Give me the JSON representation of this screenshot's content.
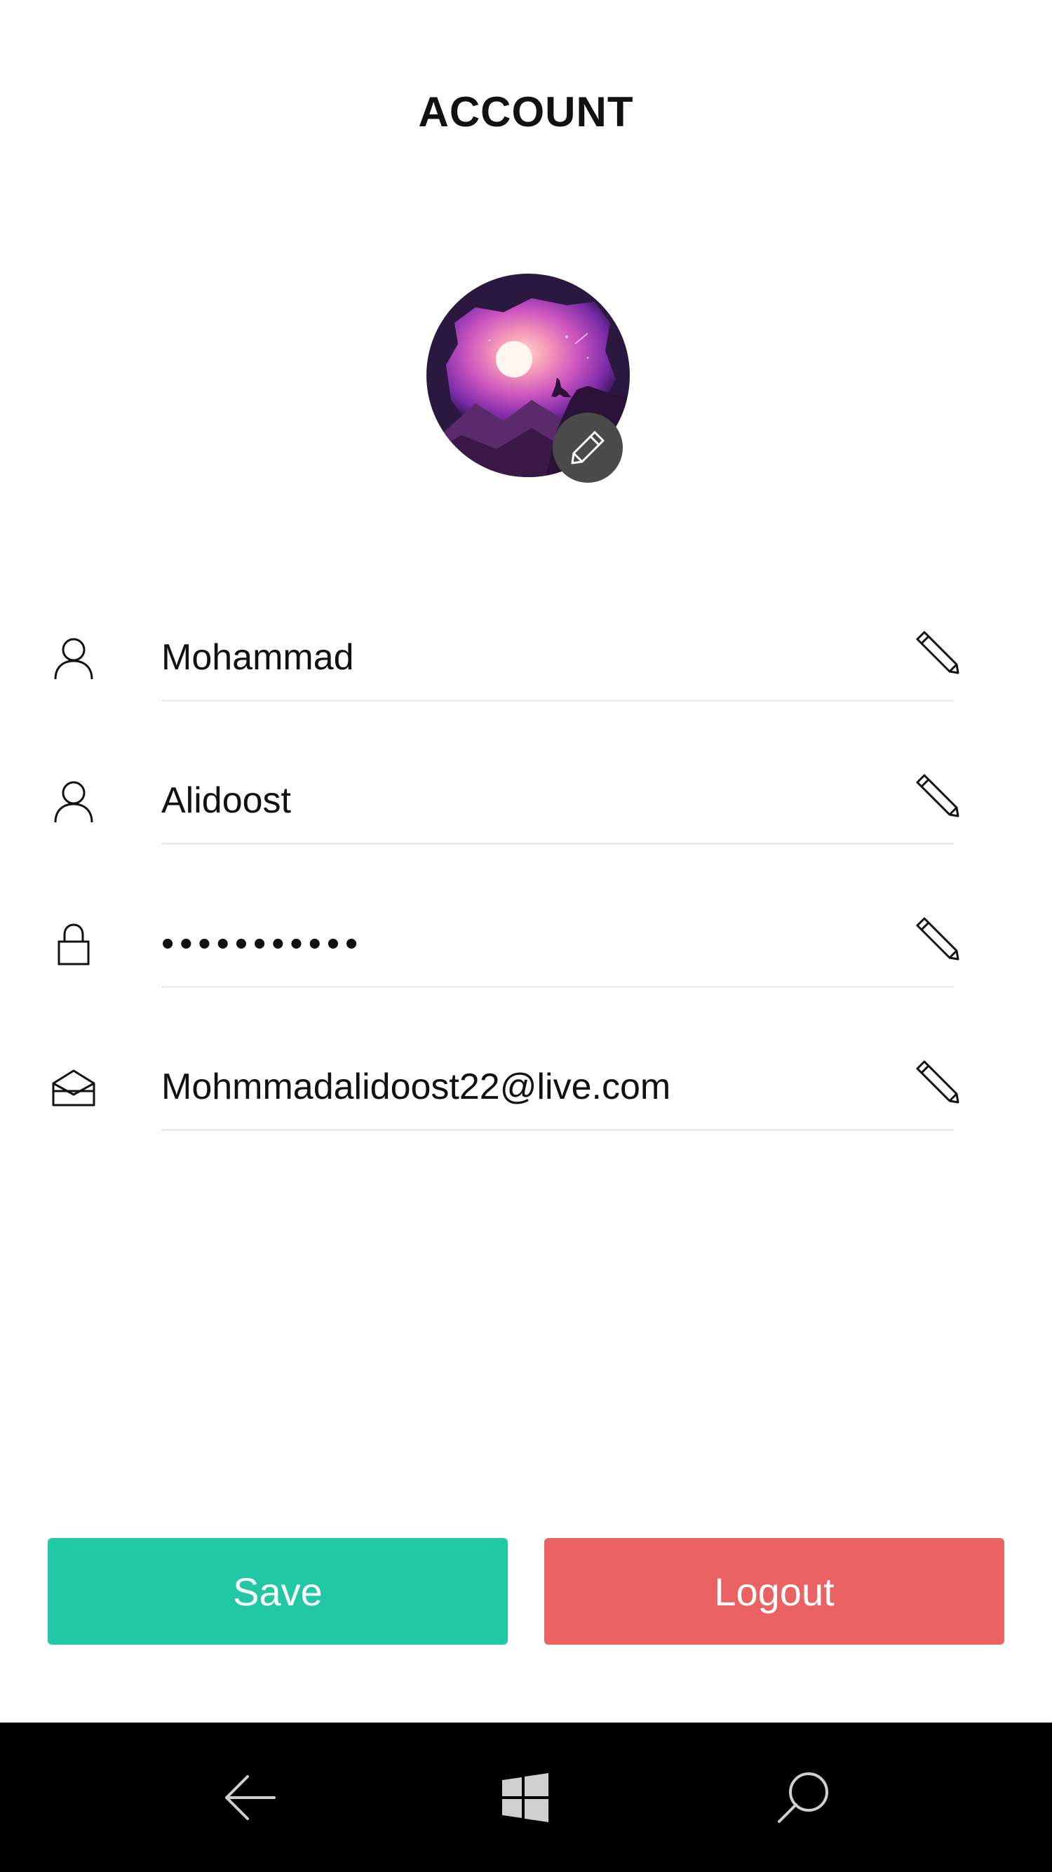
{
  "header": {
    "title": "ACCOUNT"
  },
  "avatar": {
    "image": "night-landscape-wolf-moon",
    "edit_icon": "pencil-icon"
  },
  "fields": [
    {
      "name": "first-name",
      "icon": "user-icon",
      "value": "Mohammad",
      "edit_icon": "pencil-icon"
    },
    {
      "name": "last-name",
      "icon": "user-icon",
      "value": "Alidoost",
      "edit_icon": "pencil-icon"
    },
    {
      "name": "password",
      "icon": "lock-icon",
      "value": "•••••••••••",
      "edit_icon": "pencil-icon"
    },
    {
      "name": "email",
      "icon": "mail-icon",
      "value": "Mohmmadalidoost22@live.com",
      "edit_icon": "pencil-icon"
    }
  ],
  "actions": {
    "save_label": "Save",
    "logout_label": "Logout"
  },
  "colors": {
    "save": "#21c8a5",
    "logout": "#eb6262",
    "navbar": "#000000",
    "avatar_edit_bg": "#4a4a4a"
  },
  "navbar": {
    "items": [
      "back-arrow-icon",
      "windows-icon",
      "search-icon"
    ]
  }
}
